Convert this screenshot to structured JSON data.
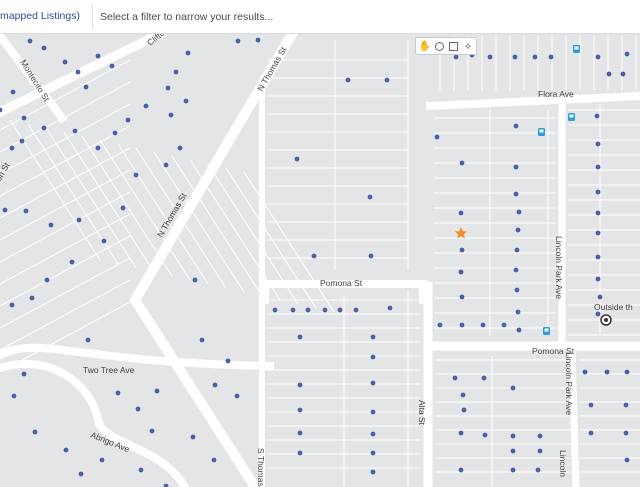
{
  "header": {
    "unmapped_label": "mapped Listings)",
    "filter_placeholder": "Select a filter to narrow your results..."
  },
  "map": {
    "road_color": "#ffffff",
    "lot_line_color": "#ffffff",
    "marker_color": "#4a5fa8",
    "star_color": "#f28c28",
    "transit_color": "#2a9fd8",
    "street_labels": {
      "clifton": "Clifton",
      "montecito": "Montecito St",
      "on_st": "on St",
      "n_thomas_upper": "N Thomas St",
      "n_thomas_lower": "N Thomas St",
      "flora": "Flora Ave",
      "pomona_west": "Pomona St",
      "pomona_east": "Pomona St",
      "two_tree": "Two Tree Ave",
      "abrigo": "Abrigo Ave",
      "alta": "Alta St",
      "lincoln_park_upper": "Lincoln Park Ave",
      "lincoln_park_lower": "Lincoln Park Ave",
      "thomas_s": "S Thomas",
      "lincoln_bottom": "Lincoln",
      "outside": "Outside th"
    },
    "tools": [
      "hand-icon",
      "circle-icon",
      "square-icon",
      "polygon-icon"
    ]
  }
}
